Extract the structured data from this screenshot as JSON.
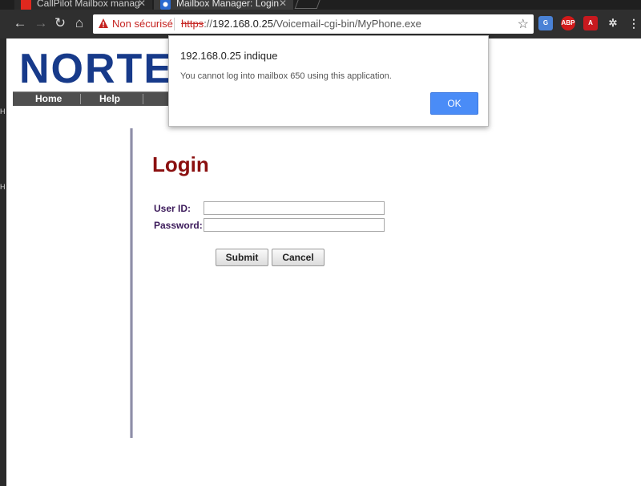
{
  "browser": {
    "tabs": [
      {
        "title": "CallPilot Mailbox manag",
        "active": false
      },
      {
        "title": "Mailbox Manager: Login",
        "active": true
      }
    ],
    "security_label": "Non sécurisé",
    "url": {
      "scheme": "https",
      "host": "192.168.0.25",
      "path": "/Voicemail-cgi-bin/MyPhone.exe"
    },
    "extensions": [
      "translate-icon",
      "adblock-icon",
      "pdf-icon",
      "extension-icon"
    ],
    "colors": {
      "chrome": "#2f2f2f",
      "insecure": "#c5221f"
    }
  },
  "page": {
    "logo_text": "NORTE",
    "menu": [
      {
        "label": "Home"
      },
      {
        "label": "Help"
      }
    ],
    "login": {
      "title": "Login",
      "user_id_label": "User ID:",
      "user_id_value": "",
      "password_label": "Password:",
      "password_value": "",
      "submit_label": "Submit",
      "cancel_label": "Cancel"
    },
    "colors": {
      "title": "#8b1010",
      "labels": "#3b1a5a",
      "logo": "#173a8a"
    }
  },
  "dialog": {
    "title": "192.168.0.25 indique",
    "message": "You cannot log into mailbox 650 using this application.",
    "ok_label": "OK",
    "ok_color": "#4a8cf7"
  }
}
